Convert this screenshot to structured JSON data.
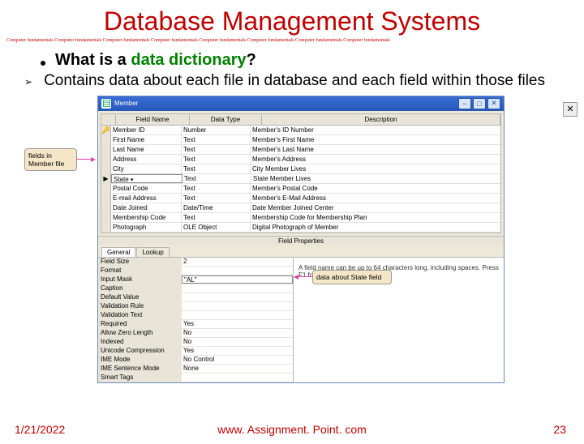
{
  "title": "Database Management Systems",
  "banner": "Computer fundamentals Computer fundamentals Computer fundamentals Computer fundamentals Computer fundamentals Computer fundamentals Computer fundamentals Computer fundamentals",
  "bullet": {
    "prefix": "What is a ",
    "term": "data dictionary",
    "suffix": "?"
  },
  "sub": "Contains data about each file in database and each field within those files",
  "callout_left": "fields in Member file",
  "callout_right": "data about State field",
  "window": {
    "title": "Member",
    "cols": {
      "c1": "Field Name",
      "c2": "Data Type",
      "c3": "Description"
    },
    "rows": [
      {
        "s": "▶",
        "f": "Member ID",
        "t": "Number",
        "d": "Member's ID Number",
        "active": false,
        "key": true
      },
      {
        "s": "",
        "f": "First Name",
        "t": "Text",
        "d": "Member's First Name"
      },
      {
        "s": "",
        "f": "Last Name",
        "t": "Text",
        "d": "Member's Last Name"
      },
      {
        "s": "",
        "f": "Address",
        "t": "Text",
        "d": "Member's Address"
      },
      {
        "s": "",
        "f": "City",
        "t": "Text",
        "d": "City Member Lives"
      },
      {
        "s": "▶",
        "f": "State",
        "t": "Text",
        "d": "State Member Lives",
        "active": true
      },
      {
        "s": "",
        "f": "Postal Code",
        "t": "Text",
        "d": "Member's Postal Code"
      },
      {
        "s": "",
        "f": "E-mail Address",
        "t": "Text",
        "d": "Member's E-Mail Address"
      },
      {
        "s": "",
        "f": "Date Joined",
        "t": "Date/Time",
        "d": "Date Member Joined Center"
      },
      {
        "s": "",
        "f": "Membership Code",
        "t": "Text",
        "d": "Membership Code for Membership Plan"
      },
      {
        "s": "",
        "f": "Photograph",
        "t": "OLE Object",
        "d": "Digital Photograph of Member"
      }
    ],
    "props_title": "Field Properties",
    "tabs": {
      "general": "General",
      "lookup": "Lookup"
    },
    "props": [
      {
        "k": "Field Size",
        "v": "2"
      },
      {
        "k": "Format",
        "v": ""
      },
      {
        "k": "Input Mask",
        "v": "\"AL\"",
        "sel": true
      },
      {
        "k": "Caption",
        "v": ""
      },
      {
        "k": "Default Value",
        "v": ""
      },
      {
        "k": "Validation Rule",
        "v": ""
      },
      {
        "k": "Validation Text",
        "v": ""
      },
      {
        "k": "Required",
        "v": "Yes"
      },
      {
        "k": "Allow Zero Length",
        "v": "No"
      },
      {
        "k": "Indexed",
        "v": "No"
      },
      {
        "k": "Unicode Compression",
        "v": "Yes"
      },
      {
        "k": "IME Mode",
        "v": "No Control"
      },
      {
        "k": "IME Sentence Mode",
        "v": "None"
      },
      {
        "k": "Smart Tags",
        "v": ""
      }
    ],
    "help": "A field name can be up to 64 characters long, including spaces. Press F1 for help on field names."
  },
  "footer": {
    "date": "1/21/2022",
    "site": "www. Assignment. Point. com",
    "page": "23"
  }
}
